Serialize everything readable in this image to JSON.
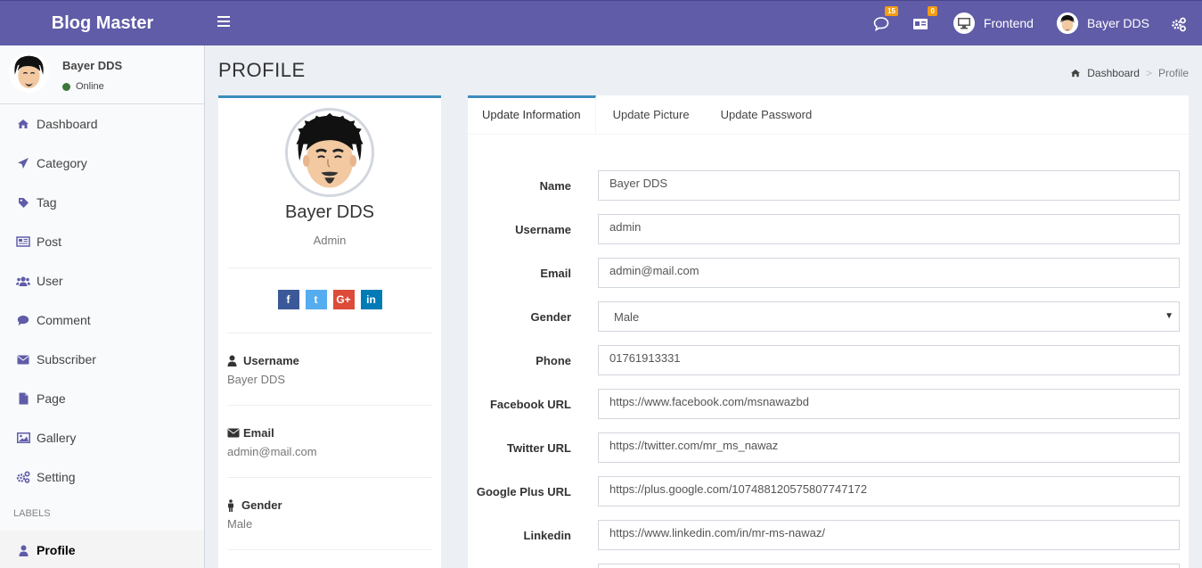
{
  "app": {
    "brand": "Blog Master"
  },
  "header": {
    "messages_count": "15",
    "notifications_count": "0",
    "frontend_label": "Frontend",
    "user_name": "Bayer DDS"
  },
  "sidebar": {
    "user_name": "Bayer DDS",
    "status": "Online",
    "items": [
      {
        "label": "Dashboard",
        "icon": "home-icon"
      },
      {
        "label": "Category",
        "icon": "paper-plane-icon"
      },
      {
        "label": "Tag",
        "icon": "tag-icon"
      },
      {
        "label": "Post",
        "icon": "newspaper-icon"
      },
      {
        "label": "User",
        "icon": "users-icon"
      },
      {
        "label": "Comment",
        "icon": "comment-icon"
      },
      {
        "label": "Subscriber",
        "icon": "envelope-icon"
      },
      {
        "label": "Page",
        "icon": "file-icon"
      },
      {
        "label": "Gallery",
        "icon": "image-icon"
      },
      {
        "label": "Setting",
        "icon": "gears-icon"
      }
    ],
    "labels_header": "LABELS",
    "profile_item": "Profile"
  },
  "page": {
    "title": "PROFILE",
    "breadcrumb": {
      "home": "Dashboard",
      "sep": ">",
      "current": "Profile"
    }
  },
  "profile_card": {
    "name": "Bayer DDS",
    "role": "Admin",
    "socials": [
      "f",
      "t",
      "G+",
      "in"
    ],
    "info": [
      {
        "label": "Username",
        "value": "Bayer DDS"
      },
      {
        "label": "Email",
        "value": "admin@mail.com"
      },
      {
        "label": "Gender",
        "value": "Male"
      }
    ]
  },
  "tabs": [
    "Update Information",
    "Update Picture",
    "Update Password"
  ],
  "form": {
    "name": {
      "label": "Name",
      "value": "Bayer DDS"
    },
    "username": {
      "label": "Username",
      "value": "admin"
    },
    "email": {
      "label": "Email",
      "value": "admin@mail.com"
    },
    "gender": {
      "label": "Gender",
      "value": "Male"
    },
    "phone": {
      "label": "Phone",
      "value": "01761913331"
    },
    "facebook": {
      "label": "Facebook URL",
      "value": "https://www.facebook.com/msnawazbd"
    },
    "twitter": {
      "label": "Twitter URL",
      "value": "https://twitter.com/mr_ms_nawaz"
    },
    "google": {
      "label": "Google Plus URL",
      "value": "https://plus.google.com/107488120575807747172"
    },
    "linkedin": {
      "label": "Linkedin",
      "value": "https://www.linkedin.com/in/mr-ms-nawaz/"
    }
  },
  "colors": {
    "header": "#605ca8",
    "accent": "#3c8dbc",
    "badge": "#f39c12",
    "facebook": "#3b5998",
    "twitter": "#55acee",
    "google": "#dd4b39",
    "linkedin": "#007bb6"
  }
}
